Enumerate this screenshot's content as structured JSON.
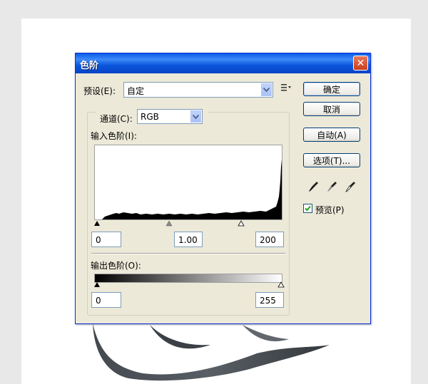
{
  "dialog": {
    "title": "色阶",
    "preset_label": "预设(E):",
    "preset_value": "自定",
    "channel_label": "通道(C):",
    "channel_value": "RGB",
    "input_levels_label": "输入色阶(I):",
    "input_black": "0",
    "input_gamma": "1.00",
    "input_white": "200",
    "output_levels_label": "输出色阶(O):",
    "output_black": "0",
    "output_white": "255",
    "buttons": {
      "ok": "确定",
      "cancel": "取消",
      "auto": "自动(A)",
      "options": "选项(T)..."
    },
    "preview_label": "预览(P)",
    "preview_checked": true
  },
  "icons": {
    "close": "close-icon",
    "menu": "preset-menu-icon",
    "black_eyedropper": "black-eyedropper-icon",
    "gray_eyedropper": "gray-eyedropper-icon",
    "white_eyedropper": "white-eyedropper-icon"
  },
  "colors": {
    "titlebar": "#0a5be8",
    "dialog_bg": "#ece9d8",
    "close_button": "#c83e1d"
  }
}
